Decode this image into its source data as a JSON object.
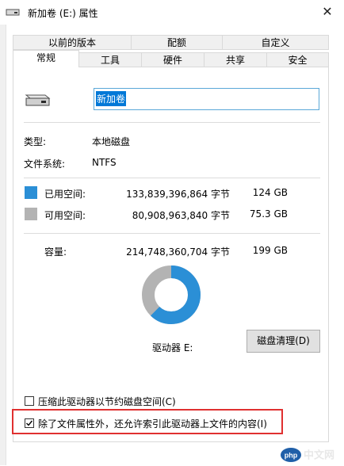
{
  "window": {
    "title": "新加卷 (E:) 属性",
    "close_glyph": "✕"
  },
  "tabs_row1": [
    "以前的版本",
    "配额",
    "自定义"
  ],
  "tabs_row2": [
    "常规",
    "工具",
    "硬件",
    "共享",
    "安全"
  ],
  "active_tab": "常规",
  "general": {
    "drive_name": "新加卷",
    "type_label": "类型:",
    "type_value": "本地磁盘",
    "fs_label": "文件系统:",
    "fs_value": "NTFS",
    "used": {
      "label": "已用空间:",
      "bytes": "133,839,396,864 字节",
      "size": "124 GB",
      "color": "#2b8fd6"
    },
    "free": {
      "label": "可用空间:",
      "bytes": "80,908,963,840 字节",
      "size": "75.3 GB",
      "color": "#b3b3b3"
    },
    "capacity": {
      "label": "容量:",
      "bytes": "214,748,360,704 字节",
      "size": "199 GB"
    },
    "used_fraction": 0.623,
    "drive_label": "驱动器 E:",
    "cleanup_button": "磁盘清理(D)",
    "compress_option": {
      "label": "压缩此驱动器以节约磁盘空间(C)",
      "checked": false
    },
    "index_option": {
      "label": "除了文件属性外，还允许索引此驱动器上文件的内容(I)",
      "checked": true
    }
  },
  "watermark": "php中文网"
}
